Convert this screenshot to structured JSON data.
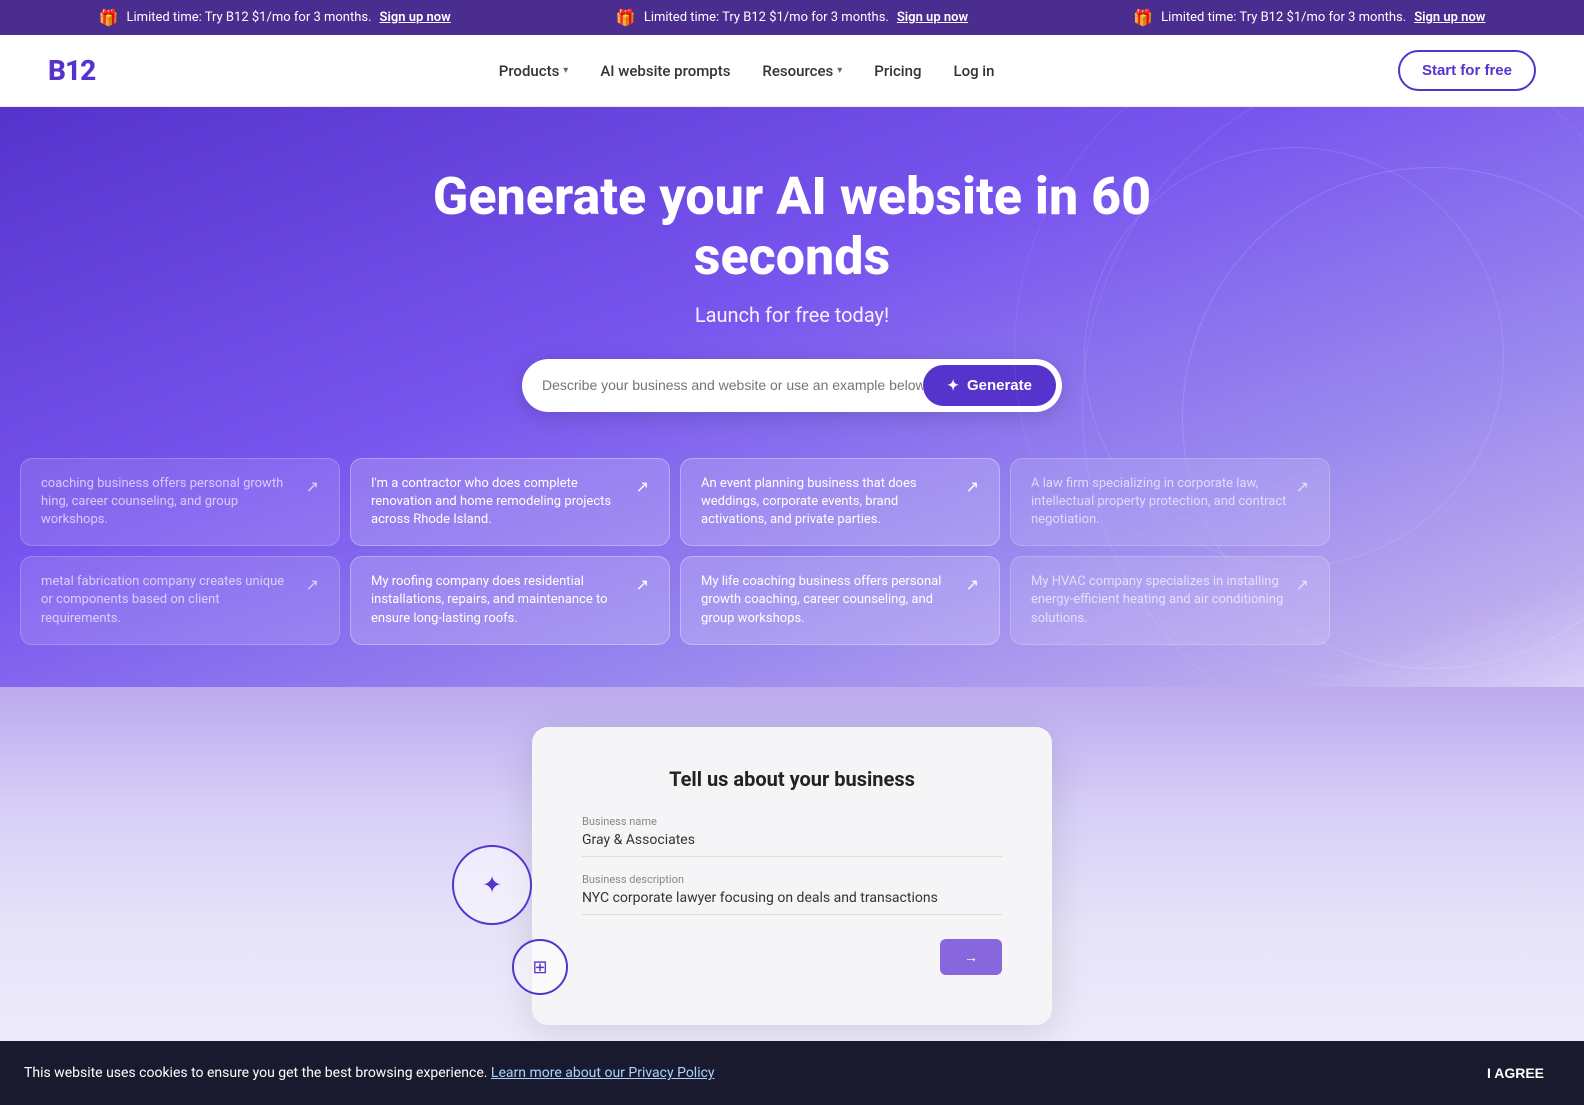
{
  "banner": {
    "message": "Limited time: Try B12 $1/mo for 3 months.",
    "cta": "Sign up now",
    "items": [
      {
        "message": "Limited time: Try B12 $1/mo for 3 months.",
        "cta": "Sign up now"
      },
      {
        "message": "Limited time: Try B12 $1/mo for 3 months.",
        "cta": "Sign up now"
      },
      {
        "message": "Limited time: Try B12 $1/mo for 3 months.",
        "cta": "Sign up now"
      }
    ]
  },
  "nav": {
    "logo": "B12",
    "links": [
      {
        "label": "Products",
        "hasDropdown": true
      },
      {
        "label": "AI website prompts",
        "hasDropdown": false
      },
      {
        "label": "Resources",
        "hasDropdown": true
      },
      {
        "label": "Pricing",
        "hasDropdown": false
      },
      {
        "label": "Log in",
        "hasDropdown": false
      }
    ],
    "start_btn": "Start for free"
  },
  "hero": {
    "title": "Generate your AI website in 60 seconds",
    "subtitle": "Launch for free today!",
    "search_placeholder": "Describe your business and website or use an example below...",
    "generate_btn": "Generate"
  },
  "example_cards": {
    "row1": [
      {
        "text": "coaching business offers personal growth hing, career counseling, and group workshops.",
        "partial": "left"
      },
      {
        "text": "I'm a contractor who does complete renovation and home remodeling projects across Rhode Island.",
        "partial": "none"
      },
      {
        "text": "An event planning business that does weddings, corporate events, brand activations, and private parties.",
        "partial": "none"
      },
      {
        "text": "A law firm specializing in corporate law, intellectual property protection, and contract negotiation.",
        "partial": "right"
      }
    ],
    "row2": [
      {
        "text": "metal fabrication company creates unique or components based on client requirements.",
        "partial": "left"
      },
      {
        "text": "My roofing company does residential installations, repairs, and maintenance to ensure long-lasting roofs.",
        "partial": "none"
      },
      {
        "text": "My life coaching business offers personal growth coaching, career counseling, and group workshops.",
        "partial": "none"
      },
      {
        "text": "My HVAC company specializes in installing energy-efficient heating and air conditioning solutions.",
        "partial": "right"
      }
    ]
  },
  "preview": {
    "title": "Tell us about your business",
    "business_name_label": "Business name",
    "business_name_value": "Gray & Associates",
    "business_desc_label": "Business description",
    "business_desc_value": "NYC corporate lawyer focusing on deals and transactions",
    "next_btn": "→"
  },
  "cookie": {
    "text": "This website uses cookies to ensure you get the best browsing experience.",
    "link_text": "Learn more about our Privacy Policy",
    "agree_btn": "I AGREE"
  }
}
